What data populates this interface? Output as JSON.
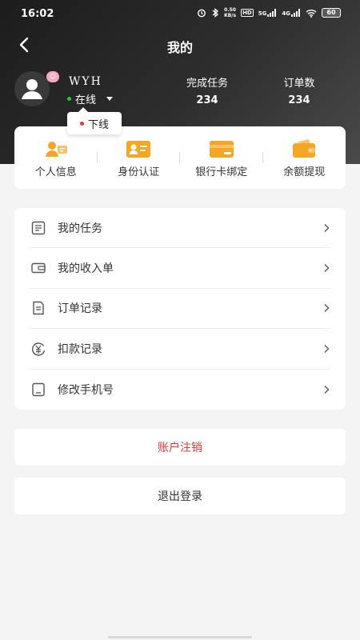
{
  "status_bar": {
    "time": "16:02",
    "net_speed_top": "0.50",
    "net_speed_bottom": "KB/s",
    "hd": "HD",
    "signal_5g": "5G",
    "signal_4g": "4G",
    "battery": "60"
  },
  "nav": {
    "title": "我的"
  },
  "profile": {
    "username": "WYH",
    "status": "在线",
    "status_option": "下线"
  },
  "stats": {
    "tasks_label": "完成任务",
    "tasks_value": "234",
    "orders_label": "订单数",
    "orders_value": "234"
  },
  "quick_actions": [
    {
      "label": "个人信息",
      "icon": "id-card-icon"
    },
    {
      "label": "身份认证",
      "icon": "identity-card-icon"
    },
    {
      "label": "银行卡绑定",
      "icon": "bank-card-icon"
    },
    {
      "label": "余额提现",
      "icon": "wallet-icon"
    }
  ],
  "menu": [
    {
      "label": "我的任务",
      "icon": "task-list-icon"
    },
    {
      "label": "我的收入单",
      "icon": "income-wallet-icon"
    },
    {
      "label": "订单记录",
      "icon": "order-record-icon"
    },
    {
      "label": "扣款记录",
      "icon": "deduction-yen-icon"
    },
    {
      "label": "修改手机号",
      "icon": "phone-icon"
    }
  ],
  "buttons": {
    "cancel_account": "账户注销",
    "logout": "退出登录"
  },
  "colors": {
    "accent_orange": "#f5a623",
    "danger_red": "#e53b3b",
    "online_green": "#1fcb3c",
    "header_dark": "#1c1c1c"
  }
}
